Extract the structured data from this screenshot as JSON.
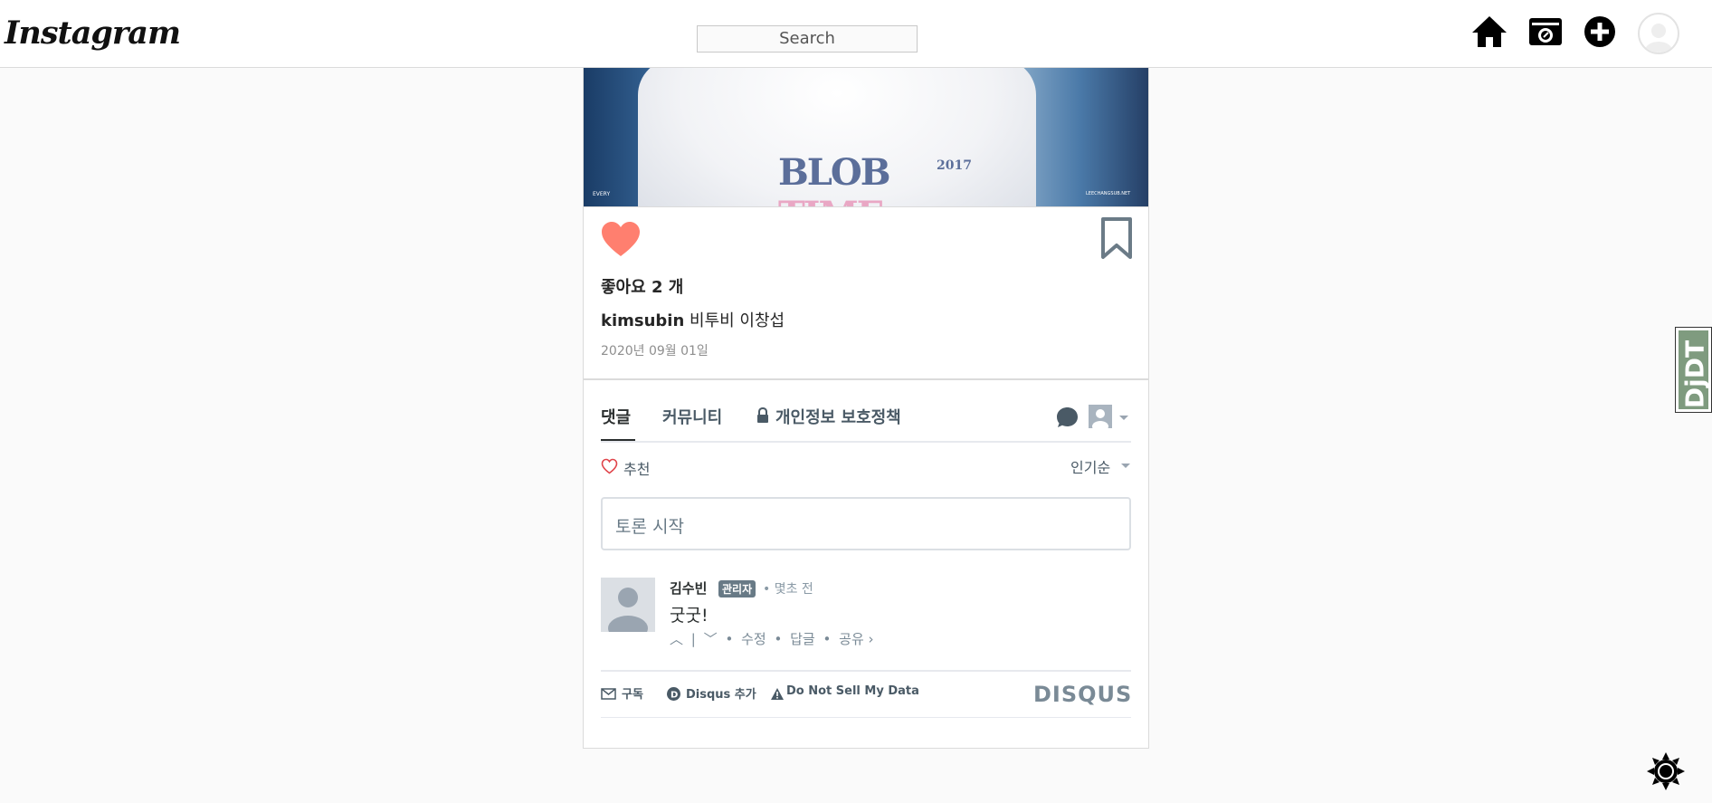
{
  "header": {
    "logo": "Instagram",
    "search_placeholder": "Search",
    "nav_icons": [
      "home-icon",
      "camera-icon",
      "plus-icon",
      "avatar"
    ]
  },
  "post": {
    "image": {
      "shirt_text": "BLOB",
      "shirt_text_pink": "TIME",
      "year": "2017",
      "watermark_left": "EVERY",
      "watermark_right": "LEECHANGSUB.NET"
    },
    "liked": true,
    "likes_text": "좋아요 2 개",
    "caption_user": "kimsubin",
    "caption_text": "비투비 이창섭",
    "date": "2020년 09월 01일"
  },
  "disqus": {
    "tabs": [
      "댓글",
      "커뮤니티",
      "개인정보 보호정책"
    ],
    "active_tab": "댓글",
    "recommend_label": "추천",
    "sort_label": "인기순",
    "input_placeholder": "토론 시작",
    "comment": {
      "author": "김수빈",
      "badge": "관리자",
      "time": "몇초 전",
      "text": "굿굿!",
      "actions": {
        "edit": "수정",
        "reply": "답글",
        "share": "공유 ›"
      }
    },
    "footer": {
      "subscribe": "구독",
      "add_disqus": "Disqus 추가",
      "do_not_sell": "Do Not Sell My Data",
      "logo": "DISQUS"
    }
  },
  "debug_toolbar": {
    "label": "DjDT"
  },
  "colors": {
    "like_heart": "#ff7f6f",
    "disqus_text": "#4a5a66",
    "border": "#dbdbdb"
  }
}
